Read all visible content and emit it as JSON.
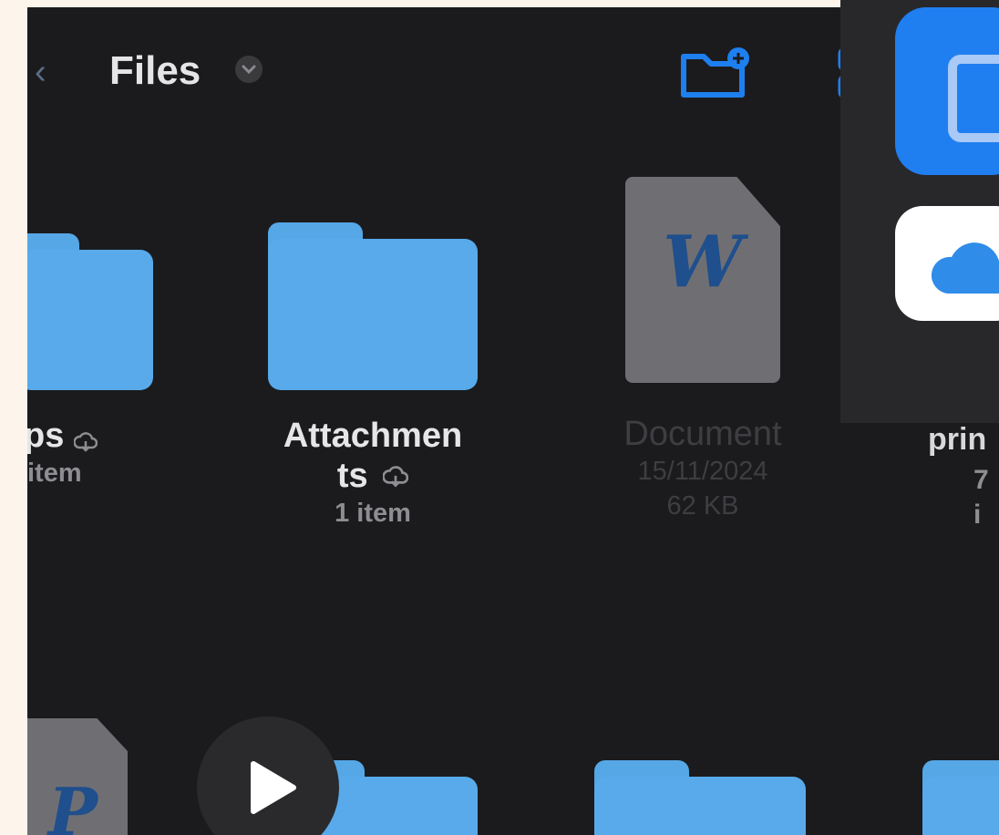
{
  "header": {
    "title": "Files",
    "new_folder_icon": "folder-badge-plus-icon",
    "grid_icon": "grid-view-icon",
    "chevron_icon": "chevron-down-icon",
    "accent_color": "#1E7FEF"
  },
  "items": [
    {
      "name": "ps",
      "subtitle": "item",
      "icon": "folder-icon",
      "cloud_icon": "cloud-download-icon"
    },
    {
      "name_line1": "Attachmen",
      "name_line2": "ts",
      "subtitle": "1 item",
      "icon": "folder-icon",
      "cloud_icon": "cloud-download-icon"
    },
    {
      "name": "Document",
      "date": "15/11/2024",
      "size": "62 KB",
      "icon": "word-document-icon",
      "letter": "W"
    },
    {
      "name": "prin",
      "subtitle": "7 i"
    }
  ],
  "bottom_row": {
    "doc_letter": "P",
    "play_icon": "play-icon"
  },
  "overlay": {
    "top_app_icon": "blue-app-icon",
    "second_app_icon": "cloud-app-icon"
  }
}
